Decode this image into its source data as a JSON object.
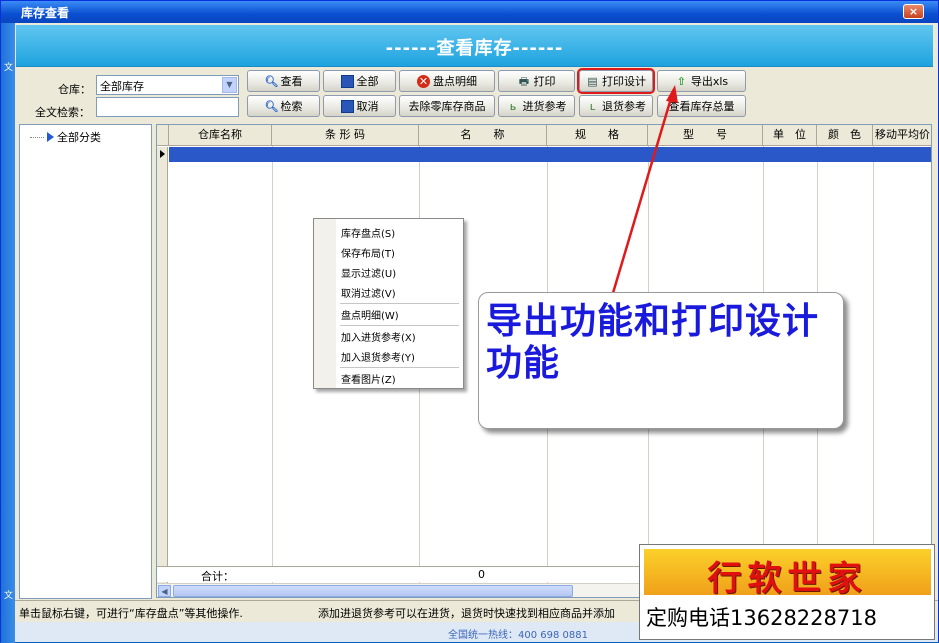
{
  "window": {
    "title": "库存查看",
    "close_label": "×"
  },
  "left_strip": {
    "top_char": "文",
    "bottom_char": "文"
  },
  "banner": {
    "title": "------查看库存------"
  },
  "filters": {
    "warehouse_label": "仓库：",
    "warehouse_value": "全部库存",
    "fulltext_label": "全文检索：",
    "fulltext_value": ""
  },
  "toolbar": {
    "view": "查看",
    "all": "全部",
    "count_detail": "盘点明细",
    "print": "打印",
    "print_design": "打印设计",
    "export_xls": "导出xls",
    "search": "检索",
    "cancel": "取消",
    "remove_zero": "去除零库存商品",
    "purchase_ref": "进货参考",
    "return_ref": "退货参考",
    "view_total": "查看库存总量"
  },
  "tree": {
    "root": "全部分类"
  },
  "grid": {
    "columns": [
      "仓库名称",
      "条 形 码",
      "名　　称",
      "规　　格",
      "型　　号",
      "单　位",
      "颜　色",
      "移动平均价"
    ],
    "sum_label": "合计：",
    "sum_value": "0"
  },
  "context_menu": {
    "items": [
      "库存盘点(S)",
      "保存布局(T)",
      "显示过滤(U)",
      "取消过滤(V)",
      "盘点明细(W)",
      "加入进货参考(X)",
      "加入退货参考(Y)",
      "查看图片(Z)"
    ]
  },
  "callout": {
    "text": "导出功能和打印设计功能"
  },
  "status": {
    "left": "单击鼠标右键，可进行“库存盘点”等其他操作.",
    "right": "添加进退货参考可以在进货，退货时快速找到相应商品并添加"
  },
  "hotline": {
    "text": "全国统一热线：400 698 0881"
  },
  "watermark": {
    "brand": "行软世家",
    "phone": "定购电话13628228718"
  },
  "colors": {
    "title_bar": "#0a4fd0",
    "banner": "#1ea3df",
    "selected_row": "#2a58c8",
    "callout_text": "#1a1adc",
    "arrow": "#e01a1a"
  }
}
